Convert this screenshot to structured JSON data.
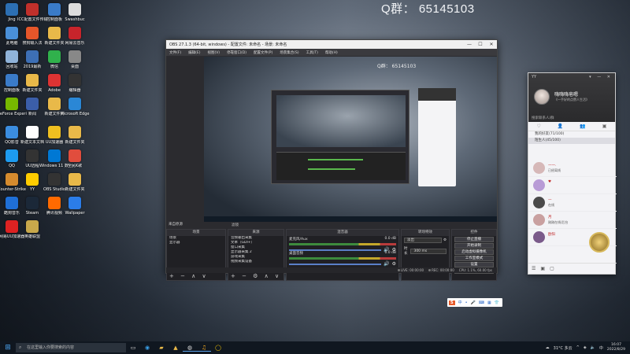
{
  "overlay": {
    "qq_group": "Q群：  65145103"
  },
  "desktop": {
    "icons": [
      {
        "label": "Jing",
        "color": "#2c6fb3"
      },
      {
        "label": "ICC配置文件传输",
        "color": "#c0302b"
      },
      {
        "label": "控制面板",
        "color": "#3a7bc8"
      },
      {
        "label": "Swashbuc",
        "color": "#ddd"
      },
      {
        "label": "此电脑",
        "color": "#4a90d9"
      },
      {
        "label": "搜狗输入法",
        "color": "#e5562a"
      },
      {
        "label": "新建文件夹",
        "color": "#e9b949"
      },
      {
        "label": "网易云音乐",
        "color": "#c7242b"
      },
      {
        "label": "回收站",
        "color": "#8fb3d9"
      },
      {
        "label": "2019最新",
        "color": "#3d6fb5"
      },
      {
        "label": "微信",
        "color": "#30b14c"
      },
      {
        "label": "桌面",
        "color": "#888"
      },
      {
        "label": "控制面板",
        "color": "#3a7bc8"
      },
      {
        "label": "新建文件夹",
        "color": "#e9b949"
      },
      {
        "label": "Adobe",
        "color": "#d33"
      },
      {
        "label": "编辑器",
        "color": "#333"
      },
      {
        "label": "GeForce Experience",
        "color": "#76b900"
      },
      {
        "label": "新闻",
        "color": "#3b5ea8"
      },
      {
        "label": "新建文件夹",
        "color": "#e9b949"
      },
      {
        "label": "Microsoft Edge",
        "color": "#2a87d6"
      },
      {
        "label": "QQ影音",
        "color": "#3b8de0"
      },
      {
        "label": "新建文本文档",
        "color": "#fff"
      },
      {
        "label": "UU加速器",
        "color": "#f0c020"
      },
      {
        "label": "新建文件夹",
        "color": "#e9b949"
      },
      {
        "label": "QQ",
        "color": "#1d9bf0"
      },
      {
        "label": "UU远程",
        "color": "#333"
      },
      {
        "label": "Windows 11 数字永久激活",
        "color": "#0078d4"
      },
      {
        "label": "全民K歌",
        "color": "#e14d3d"
      },
      {
        "label": "Counter-Strike",
        "color": "#d58b2e"
      },
      {
        "label": "YY",
        "color": "#ffcc00"
      },
      {
        "label": "OBS Studio",
        "color": "#333"
      },
      {
        "label": "新建文件夹",
        "color": "#e9b949"
      },
      {
        "label": "酷狗音乐",
        "color": "#1f6fd6"
      },
      {
        "label": "Steam",
        "color": "#1b2838"
      },
      {
        "label": "腾讯视频",
        "color": "#ff6a00"
      },
      {
        "label": "Wallpaper",
        "color": "#2b7de9"
      },
      {
        "label": "网易UU加速器",
        "color": "#d22"
      },
      {
        "label": "英雄联盟",
        "color": "#c8a84b"
      }
    ]
  },
  "obs": {
    "title": "OBS 27.1.3 (64-bit, windows) - 配置文件: 未命名 - 场景: 未命名",
    "menu": [
      "文件(F)",
      "编辑(E)",
      "视图(V)",
      "停靠窗口(D)",
      "配置文件(P)",
      "场景集合(S)",
      "工具(T)",
      "帮助(H)"
    ],
    "inner_qq": "Q群：  65145103",
    "scene_label": "来自原源",
    "filter_label": "滤镜",
    "docks": {
      "scenes": {
        "title": "场景",
        "items": [
          "场景",
          "显示器"
        ]
      },
      "sources": {
        "title": "来源",
        "items": [
          "音频输出采集",
          "文本（GDI+）",
          "窗口采集",
          "显示器采集 2",
          "游戏采集",
          "视频采集设备"
        ]
      },
      "mixer": {
        "title": "混音器",
        "tracks": [
          {
            "name": "麦克风/Aux",
            "db": "0.0 dB"
          },
          {
            "name": "桌面音频",
            "db": "0.0 dB"
          }
        ]
      },
      "transitions": {
        "title": "转场特效",
        "type": "淡出",
        "duration_label": "时长",
        "duration": "300 ms"
      },
      "controls": {
        "title": "控件",
        "buttons": [
          "停止直播",
          "开始录制",
          "启动虚拟摄像机",
          "工作室模式",
          "设置",
          "退出"
        ]
      }
    },
    "status": {
      "live": "LIVE: 00:00:00",
      "rec": "REC: 00:00:00",
      "cpu": "CPU: 1.1%, 60.00 fps"
    }
  },
  "qq_panel": {
    "header": "YY",
    "nickname": "嗨嗨嗨皂嗯",
    "signature": "《一手好的点赞人生活》",
    "search": "搜索联系人/群",
    "rows": [
      "我的好友(71/100)",
      "陌生人(45/100)"
    ],
    "contacts": [
      {
        "name": "一一.",
        "status": "已经离线",
        "avatar": "#d6b8b8"
      },
      {
        "name": "♥",
        "status": "",
        "avatar": "#b89bd6"
      },
      {
        "name": "一",
        "status": "在线",
        "avatar": "#4a4a4a"
      },
      {
        "name": "月",
        "status": "刚刚在线/后台",
        "avatar": "#c9a0a0"
      },
      {
        "name": "欧阳",
        "status": "",
        "avatar": "#7a5a8a"
      }
    ],
    "bottom_icons": [
      "☰",
      "▣",
      "▢"
    ]
  },
  "mini_toolbar": {
    "logo": "S",
    "icons": [
      "中",
      "•",
      "🎤",
      "⌨",
      "▦",
      "👕"
    ]
  },
  "taskbar": {
    "search_placeholder": "在这里输入你要搜索的内容",
    "weather": "31°C  多云",
    "time": "16:07",
    "date": "2022/8/29"
  }
}
